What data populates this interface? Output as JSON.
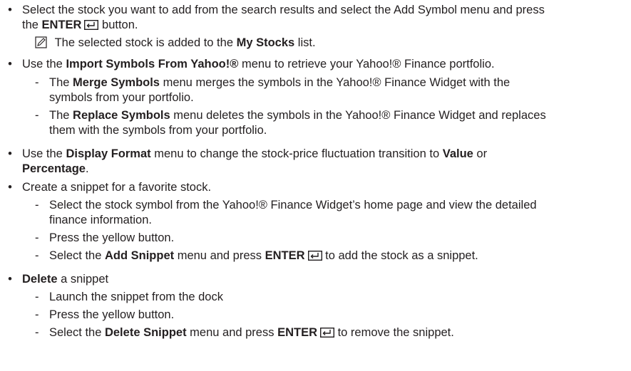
{
  "b1": {
    "l1": "Select the stock you want to add from the search results and select the Add Symbol menu and press",
    "l2_a": "the ",
    "l2_b": "ENTER",
    "l2_c": " button.",
    "note_a": "The selected stock is added to the ",
    "note_b": "My Stocks",
    "note_c": " list."
  },
  "b2": {
    "a": "Use the ",
    "b": "Import Symbols From Yahoo!®",
    "c": " menu to retrieve your Yahoo!® Finance portfolio.",
    "s1_a": "The ",
    "s1_b": "Merge Symbols",
    "s1_c": " menu merges the symbols in the Yahoo!® Finance Widget with the",
    "s1_l2": "symbols from your portfolio.",
    "s2_a": "The ",
    "s2_b": "Replace Symbols",
    "s2_c": " menu deletes the symbols in the Yahoo!® Finance Widget and replaces",
    "s2_l2": "them with the symbols from your portfolio."
  },
  "b3": {
    "a": "Use the ",
    "b": "Display Format",
    "c": " menu to change the stock-price fluctuation transition to ",
    "d": "Value",
    "e": " or",
    "l2_a": "Percentage",
    "l2_b": "."
  },
  "b4": {
    "text": "Create a snippet for a favorite stock.",
    "s1_l1": "Select the stock symbol from the Yahoo!® Finance Widget’s home page and view the detailed",
    "s1_l2": "finance information.",
    "s2": "Press the yellow button.",
    "s3_a": "Select the ",
    "s3_b": "Add Snippet",
    "s3_c": " menu and press ",
    "s3_d": "ENTER",
    "s3_e": " to add the stock as a snippet."
  },
  "b5": {
    "a": "Delete",
    "b": " a snippet",
    "s1": "Launch the snippet from the dock",
    "s2": "Press the yellow button.",
    "s3_a": "Select the ",
    "s3_b": "Delete Snippet",
    "s3_c": " menu and press ",
    "s3_d": "ENTER",
    "s3_e": " to remove the snippet."
  },
  "bullet_char": "•",
  "dash_char": "-",
  "icons": [
    "enter-key-icon",
    "note-pencil-icon"
  ]
}
